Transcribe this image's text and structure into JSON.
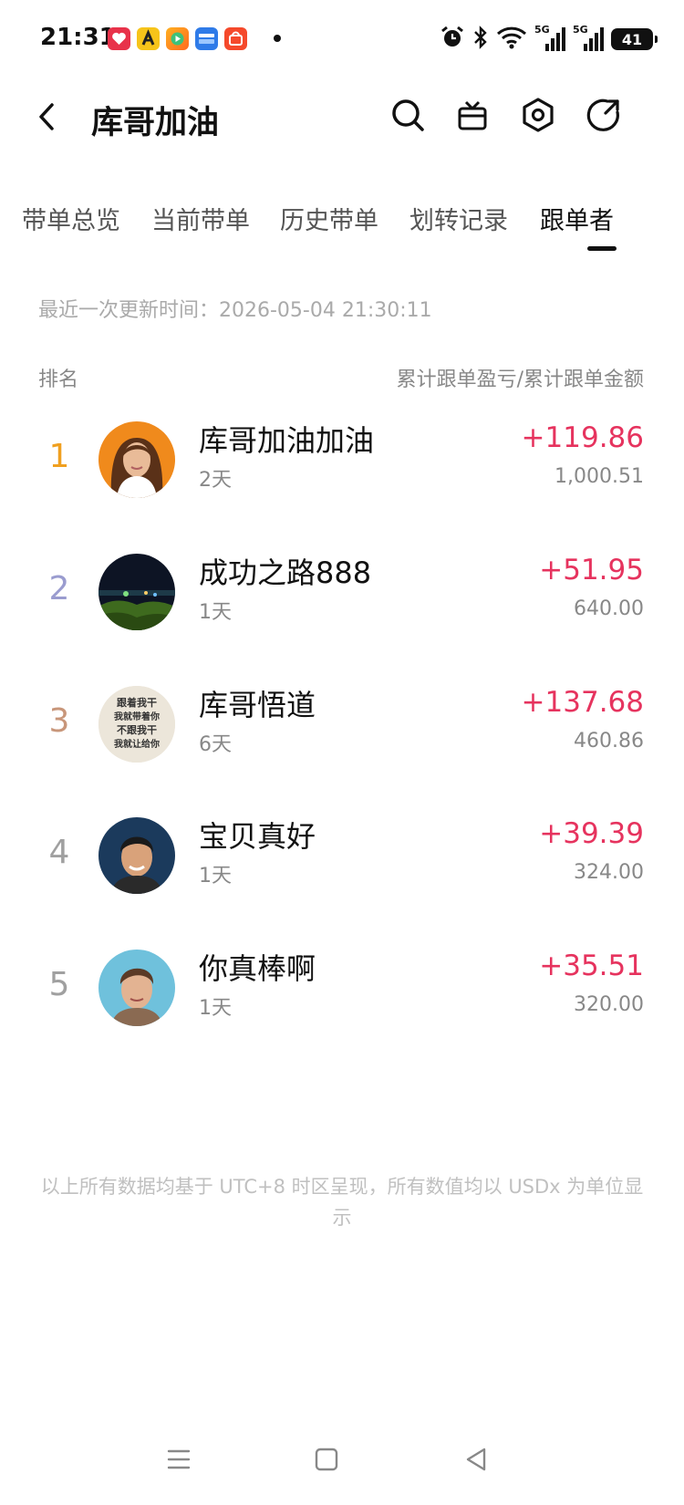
{
  "status_bar": {
    "time": "21:31",
    "network_1": "5G",
    "network_2": "5G",
    "battery": "41",
    "icons": [
      "love-app-icon",
      "a-app-icon",
      "play-app-icon",
      "car-app-icon",
      "shop-app-icon",
      "notification-dot",
      "alarm-icon",
      "bluetooth-icon",
      "wifi-icon",
      "signal-icon",
      "signal-icon",
      "battery-icon"
    ]
  },
  "header": {
    "title": "库哥加油",
    "icons": [
      "back-arrow-icon",
      "search-icon",
      "gift-icon",
      "settings-hexagon-icon",
      "share-icon"
    ]
  },
  "tabs": [
    {
      "label": "带单总览",
      "active": false
    },
    {
      "label": "当前带单",
      "active": false
    },
    {
      "label": "历史带单",
      "active": false
    },
    {
      "label": "划转记录",
      "active": false
    },
    {
      "label": "跟单者",
      "active": true
    }
  ],
  "update_time": "最近一次更新时间：2026-05-04 21:30:11",
  "table_header": {
    "rank": "排名",
    "pnl": "累计跟单盈亏/累计跟单金额"
  },
  "followers": [
    {
      "rank": "1",
      "name": "库哥加油加油",
      "days": "2天",
      "pnl": "+119.86",
      "amount": "1,000.51",
      "rank_color": "#f0a020"
    },
    {
      "rank": "2",
      "name": "成功之路888",
      "days": "1天",
      "pnl": "+51.95",
      "amount": "640.00",
      "rank_color": "#9a9ccf"
    },
    {
      "rank": "3",
      "name": "库哥悟道",
      "days": "6天",
      "pnl": "+137.68",
      "amount": "460.86",
      "rank_color": "#c8967a"
    },
    {
      "rank": "4",
      "name": "宝贝真好",
      "days": "1天",
      "pnl": "+39.39",
      "amount": "324.00",
      "rank_color": "#a0a0a0"
    },
    {
      "rank": "5",
      "name": "你真棒啊",
      "days": "1天",
      "pnl": "+35.51",
      "amount": "320.00",
      "rank_color": "#a0a0a0"
    }
  ],
  "avatar_3_text": [
    "跟着我干",
    "我就带着你",
    "不跟我干",
    "我就让给你"
  ],
  "footer_note": "以上所有数据均基于 UTC+8 时区呈现，所有数值均以 USDx 为单位显示",
  "colors": {
    "profit": "#e6335e",
    "text_primary": "#111111",
    "text_secondary": "#888888"
  },
  "nav_bar": {
    "icons": [
      "menu-icon",
      "home-square-icon",
      "back-triangle-icon"
    ]
  }
}
